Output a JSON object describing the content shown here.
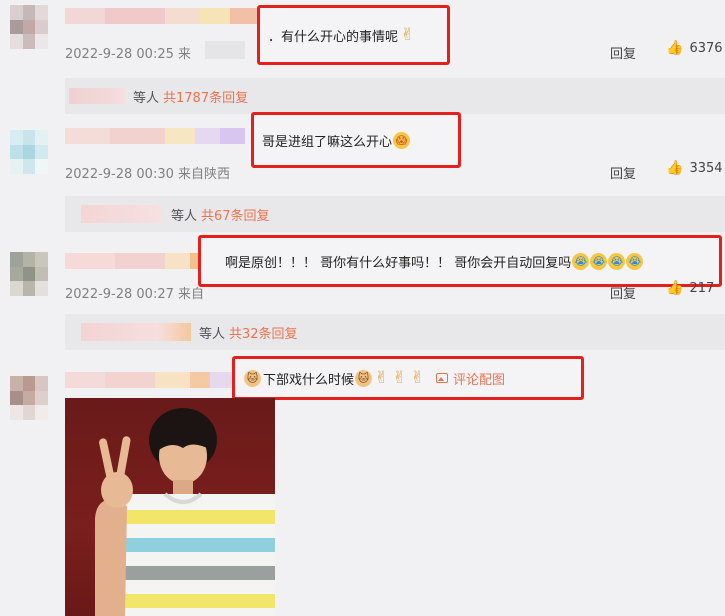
{
  "comments": [
    {
      "time": "2022-9-28 00:25 来",
      "text": "．有什么开心的事情呢",
      "emojis": [
        "✌"
      ],
      "reply_label": "回复",
      "likes": "6376",
      "thread": {
        "prefix": "等人",
        "count": "共1787条回复"
      }
    },
    {
      "time": "2022-9-28 00:30 来自陕西",
      "text": "哥是进组了嘛这么开心",
      "emojis": [
        "😱"
      ],
      "reply_label": "回复",
      "likes": "3354",
      "thread": {
        "prefix": "等人",
        "count": "共67条回复"
      }
    },
    {
      "time": "2022-9-28 00:27 来自",
      "text": "啊是原创！！！ 哥你有什么好事吗！！ 哥你会开自动回复吗",
      "emojis": [
        "😭",
        "😭",
        "😭",
        "😭"
      ],
      "reply_label": "回复",
      "likes": "217",
      "thread": {
        "prefix": "等人",
        "count": "共32条回复"
      }
    },
    {
      "text_prefix_emoji": "🐱",
      "text": "下部戏什么时候",
      "emojis": [
        "🐱",
        "✌",
        "✌",
        "✌"
      ],
      "pic_link": "评论配图",
      "photo_alt": "评论配图"
    }
  ],
  "colors": {
    "highlight": "#e3201c",
    "link": "#eb7350",
    "background": "#f1f1f3"
  }
}
